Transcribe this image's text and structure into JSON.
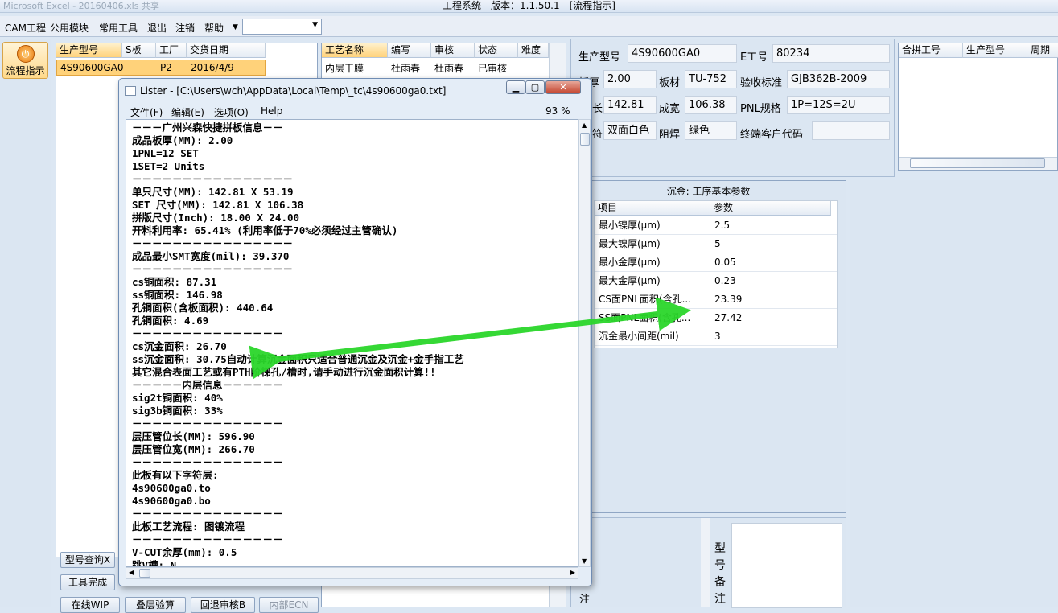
{
  "app": {
    "title": "工程系统　版本：1.1.50.1 - [流程指示]",
    "ghost_title": "Microsoft Excel - 20160406.xls 共享"
  },
  "menu": {
    "items": [
      "CAM工程",
      "公用模块",
      "常用工具",
      "退出",
      "注销",
      "帮助"
    ],
    "combo_value": ""
  },
  "sidebar": {
    "flow_button": "流程指示"
  },
  "list1": {
    "headers": [
      "生产型号",
      "S板",
      "工厂",
      "交货日期"
    ],
    "row": [
      "4S90600GA0",
      "",
      "P2",
      "2016/4/9"
    ]
  },
  "list2": {
    "headers": [
      "工艺名称",
      "编写",
      "审核",
      "状态",
      "难度"
    ],
    "row": [
      "内层干膜",
      "杜雨春",
      "杜雨春",
      "已审核",
      ""
    ]
  },
  "info": {
    "model_label": "生产型号",
    "model": "4S90600GA0",
    "eno_label": "E工号",
    "eno": "80234",
    "thick_label": "板厚",
    "thick": "2.00",
    "mat_label": "板材",
    "mat": "TU-752",
    "std_label": "验收标准",
    "std": "GJB362B-2009",
    "len_label": "长",
    "len": "142.81",
    "width_label": "成宽",
    "width": "106.38",
    "pnl_label": "PNL规格",
    "pnl": "1P=12S=2U",
    "silk_label": "符",
    "silk": "双面白色",
    "mask_label": "阻焊",
    "mask": "绿色",
    "cust_label": "终端客户代码",
    "cust": ""
  },
  "merge_grid": {
    "headers": [
      "合拼工号",
      "生产型号",
      "周期"
    ]
  },
  "params": {
    "title": "沉金: 工序基本参数",
    "col_item": "项目",
    "col_value": "参数",
    "rows": [
      {
        "item": "最小镍厚(μm)",
        "value": "2.5"
      },
      {
        "item": "最大镍厚(μm)",
        "value": "5"
      },
      {
        "item": "最小金厚(μm)",
        "value": "0.05"
      },
      {
        "item": "最大金厚(μm)",
        "value": "0.23"
      },
      {
        "item": "CS面PNL面积(含孔...",
        "value": "23.39"
      },
      {
        "item": "SS面PNL面积(含孔...",
        "value": "27.42"
      },
      {
        "item": "沉金最小间距(mil)",
        "value": "3"
      }
    ]
  },
  "remarks": {
    "note_label": "注",
    "model_remark_label": "型号备注"
  },
  "bottom_buttons": [
    "型号查询X",
    "工具完成",
    "在线WIP",
    "叠层验算",
    "回退审核B",
    "内部ECN"
  ],
  "lister": {
    "title": "Lister - [C:\\Users\\wch\\AppData\\Local\\Temp\\_tc\\4s90600ga0.txt]",
    "menu": [
      "文件(F)",
      "编辑(E)",
      "选项(O)",
      "Help"
    ],
    "zoom": "93 %",
    "lines": [
      "－－－广州兴森快捷拼板信息－－",
      "成品板厚(MM): 2.00",
      "1PNL=12 SET",
      "1SET=2 Units",
      "－－－－－－－－－－－－－－－－",
      "单只尺寸(MM): 142.81 X 53.19",
      "SET 尺寸(MM): 142.81 X 106.38",
      "拼版尺寸(Inch): 18.00 X 24.00",
      "开料利用率: 65.41% (利用率低于70%必须经过主管确认)",
      "－－－－－－－－－－－－－－－－",
      "成品最小SMT宽度(mil): 39.370",
      "－－－－－－－－－－－－－－－－",
      "cs铜面积: 87.31",
      "ss铜面积: 146.98",
      "孔铜面积(含板面积): 440.64",
      "孔铜面积: 4.69",
      "－－－－－－－－－－－－－－－",
      "cs沉金面积: 26.70",
      "ss沉金面积: 30.75自动计算沉金面积只适合普通沉金及沉金+金手指工艺",
      "其它混合表面工艺或有PTH阶梯孔/槽时,请手动进行沉金面积计算!!",
      "－－－－－内层信息－－－－－－",
      "sig2t铜面积: 40%",
      "sig3b铜面积: 33%",
      "－－－－－－－－－－－－－－－",
      "层压管位长(MM): 596.90",
      "层压管位宽(MM): 266.70",
      "－－－－－－－－－－－－－－－",
      "此板有以下字符层:",
      "4s90600ga0.to",
      "4s90600ga0.bo",
      "－－－－－－－－－－－－－－－",
      "此板工艺流程: 图镀流程",
      "－－－－－－－－－－－－－－－",
      "V-CUT余厚(mm): 0.5",
      "跳V槽: N"
    ]
  }
}
